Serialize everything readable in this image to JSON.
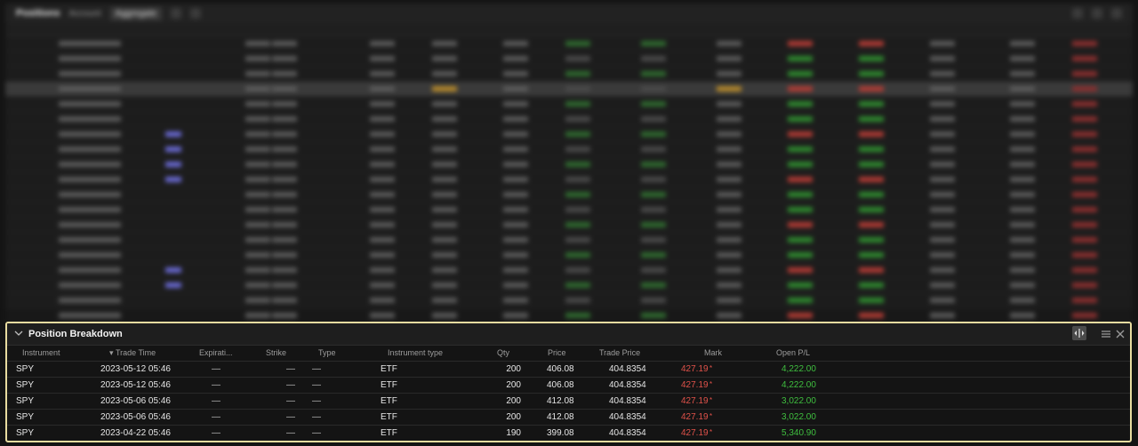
{
  "background_panel": {
    "title": "Positions",
    "account_label": "Account",
    "aggregate_label": "Aggregate"
  },
  "position_breakdown": {
    "title": "Position Breakdown",
    "columns": [
      "Instrument",
      "Trade Time",
      "Expirati...",
      "Strike",
      "Type",
      "Instrument type",
      "Qty",
      "Price",
      "Trade Price",
      "Mark",
      "Open P/L"
    ],
    "sort_indicator": "▾",
    "rows": [
      {
        "instrument": "SPY",
        "trade_time": "2023-05-12 05:46",
        "expiration": "—",
        "strike": "—",
        "type": "—",
        "instrument_type": "ETF",
        "qty": "200",
        "price": "406.08",
        "trade_price": "404.8354",
        "mark": "427.19",
        "mark_flag": "*",
        "open_pl": "4,222.00"
      },
      {
        "instrument": "SPY",
        "trade_time": "2023-05-12 05:46",
        "expiration": "—",
        "strike": "—",
        "type": "—",
        "instrument_type": "ETF",
        "qty": "200",
        "price": "406.08",
        "trade_price": "404.8354",
        "mark": "427.19",
        "mark_flag": "*",
        "open_pl": "4,222.00"
      },
      {
        "instrument": "SPY",
        "trade_time": "2023-05-06 05:46",
        "expiration": "—",
        "strike": "—",
        "type": "—",
        "instrument_type": "ETF",
        "qty": "200",
        "price": "412.08",
        "trade_price": "404.8354",
        "mark": "427.19",
        "mark_flag": "*",
        "open_pl": "3,022.00"
      },
      {
        "instrument": "SPY",
        "trade_time": "2023-05-06 05:46",
        "expiration": "—",
        "strike": "—",
        "type": "—",
        "instrument_type": "ETF",
        "qty": "200",
        "price": "412.08",
        "trade_price": "404.8354",
        "mark": "427.19",
        "mark_flag": "*",
        "open_pl": "3,022.00"
      },
      {
        "instrument": "SPY",
        "trade_time": "2023-04-22 05:46",
        "expiration": "—",
        "strike": "—",
        "type": "—",
        "instrument_type": "ETF",
        "qty": "190",
        "price": "399.08",
        "trade_price": "404.8354",
        "mark": "427.19",
        "mark_flag": "*",
        "open_pl": "5,340.90"
      }
    ]
  },
  "colors": {
    "panel_border": "#e9dca0",
    "loss": "#e0524a",
    "gain": "#3fbf3f",
    "highlight_row": "#3a3a3a"
  }
}
